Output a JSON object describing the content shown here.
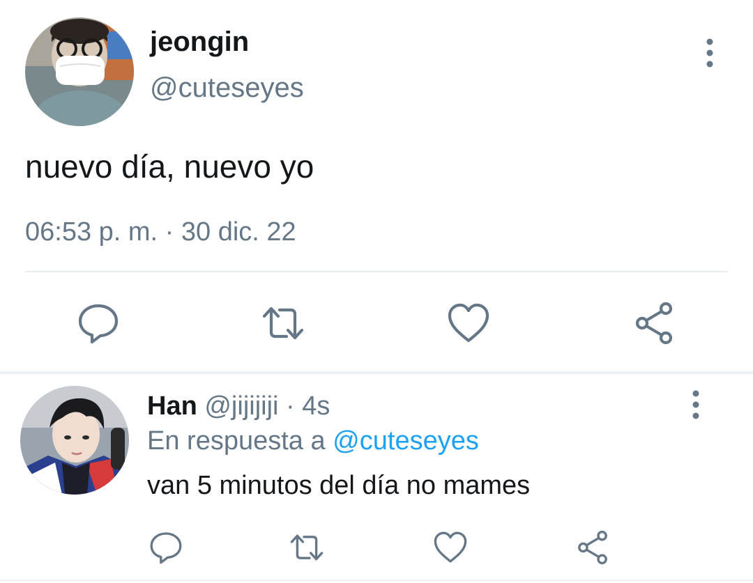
{
  "main_tweet": {
    "author_name": "jeongin",
    "author_handle": "@cuteseyes",
    "text": "nuevo día, nuevo yo",
    "timestamp": "06:53 p. m. · 30 dic. 22",
    "avatar": "avatar-photo-masked-person",
    "actions": [
      "reply-icon",
      "retweet-icon",
      "like-icon",
      "share-icon"
    ],
    "more_icon": "more-vertical-icon"
  },
  "reply_tweet": {
    "author_name": "Han",
    "author_handle": "@jijijiji",
    "time_ago": "· 4s",
    "reply_prefix": "En respuesta a",
    "reply_mention": "@cuteseyes",
    "text": "van 5 minutos del día no mames",
    "avatar": "avatar-photo-person",
    "actions": [
      "reply-icon",
      "retweet-icon",
      "like-icon",
      "share-icon"
    ],
    "more_icon": "more-vertical-icon"
  },
  "colors": {
    "text_primary": "#14171a",
    "text_secondary": "#657786",
    "link": "#1da1f2",
    "divider": "#e6ecf0"
  }
}
